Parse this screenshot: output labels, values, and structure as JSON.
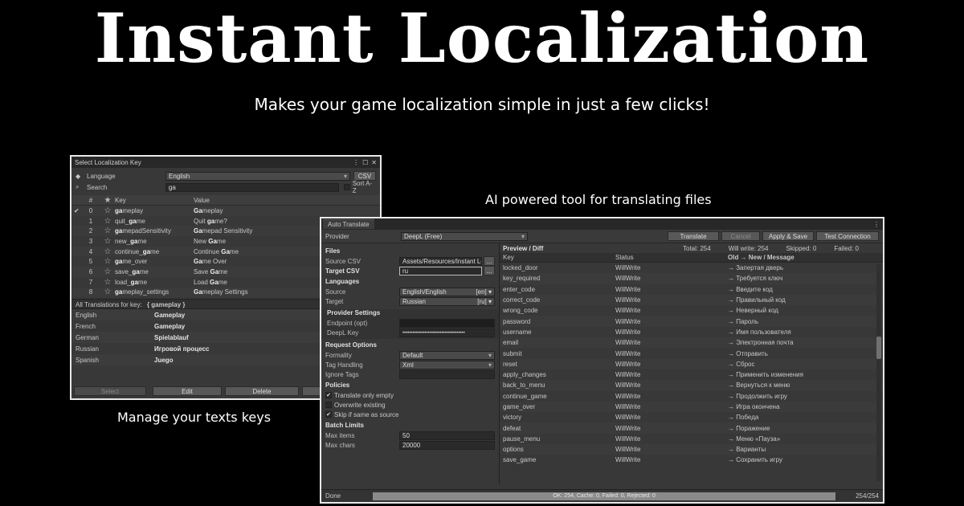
{
  "hero": {
    "title": "Instant Localization",
    "subtitle": "Makes your game localization simple in just a few clicks!"
  },
  "captions": {
    "left": "Manage your texts keys",
    "right": "AI powered tool for translating files"
  },
  "select_window": {
    "title": "Select Localization Key",
    "language_label": "Language",
    "language_value": "English",
    "csv_label": "CSV",
    "search_label": "Search",
    "search_value": "ga",
    "sort_label": "Sort A-Z",
    "col_index": "#",
    "col_key": "Key",
    "col_value": "Value",
    "rows": [
      {
        "idx": "0",
        "key_bold": "ga",
        "key_rest": "meplay",
        "val_bold": "Ga",
        "val_rest": "meplay",
        "checked": "✔"
      },
      {
        "idx": "1",
        "key_pre": "quit_",
        "key_bold": "ga",
        "key_rest": "me",
        "val_pre": "Quit ",
        "val_bold": "ga",
        "val_rest": "me?"
      },
      {
        "idx": "2",
        "key_bold": "ga",
        "key_rest": "mepadSensitivity",
        "val_bold": "Ga",
        "val_rest": "mepad Sensitivity"
      },
      {
        "idx": "3",
        "key_pre": "new_",
        "key_bold": "ga",
        "key_rest": "me",
        "val_pre": "New ",
        "val_bold": "Ga",
        "val_rest": "me"
      },
      {
        "idx": "4",
        "key_pre": "continue_",
        "key_bold": "ga",
        "key_rest": "me",
        "val_pre": "Continue ",
        "val_bold": "Ga",
        "val_rest": "me"
      },
      {
        "idx": "5",
        "key_bold": "ga",
        "key_rest": "me_over",
        "val_bold": "Ga",
        "val_rest": "me Over"
      },
      {
        "idx": "6",
        "key_pre": "save_",
        "key_bold": "ga",
        "key_rest": "me",
        "val_pre": "Save ",
        "val_bold": "Ga",
        "val_rest": "me"
      },
      {
        "idx": "7",
        "key_pre": "load_",
        "key_bold": "ga",
        "key_rest": "me",
        "val_pre": "Load ",
        "val_bold": "Ga",
        "val_rest": "me"
      },
      {
        "idx": "8",
        "key_bold": "ga",
        "key_rest": "meplay_settings",
        "val_bold": "Ga",
        "val_rest": "meplay Settings"
      }
    ],
    "all_translations_label": "All Translations for key:",
    "all_translations_key": "{ gameplay }",
    "translations": [
      {
        "lang": "English",
        "val": "Gameplay"
      },
      {
        "lang": "French",
        "val": "Gameplay"
      },
      {
        "lang": "German",
        "val": "Spielablauf"
      },
      {
        "lang": "Russian",
        "val": "Игровой процесс"
      },
      {
        "lang": "Spanish",
        "val": "Juego"
      }
    ],
    "btn_select": "Select",
    "btn_edit": "Edit",
    "btn_delete": "Delete"
  },
  "auto_window": {
    "tab": "Auto Translate",
    "provider_label": "Provider",
    "provider_value": "DeepL (Free)",
    "btn_translate": "Translate",
    "btn_cancel": "Cancel",
    "btn_apply": "Apply & Save",
    "btn_test": "Test Connection",
    "files_head": "Files",
    "source_csv_label": "Source CSV",
    "source_csv_value": "Assets/Resources/Instant Loc",
    "target_csv_label": "Target CSV",
    "target_csv_value": "ru",
    "browse": "...",
    "languages_head": "Languages",
    "source_label": "Source",
    "source_value": "English/English",
    "source_code": "[en]",
    "target_label": "Target",
    "target_value": "Russian",
    "target_code": "[ru]",
    "provider_settings_head": "Provider Settings",
    "endpoint_label": "Endpoint (opt)",
    "endpoint_value": "",
    "deepl_key_label": "DeepL Key",
    "deepl_key_value": "•••••••••••••••••••••••••••••••••••••",
    "request_head": "Request Options",
    "formality_label": "Formality",
    "formality_value": "Default",
    "tag_label": "Tag Handling",
    "tag_value": "Xml",
    "ignore_label": "Ignore Tags",
    "ignore_value": "",
    "policies_head": "Policies",
    "policy_1": "Translate only empty",
    "policy_2": "Overwrite existing",
    "policy_3": "Skip if same as source",
    "batch_head": "Batch Limits",
    "max_items_label": "Max items",
    "max_items_value": "50",
    "max_chars_label": "Max chars",
    "max_chars_value": "20000",
    "preview_head": "Preview / Diff",
    "total": "Total: 254",
    "will_write": "Will write: 254",
    "skipped": "Skipped: 0",
    "failed": "Failed: 0",
    "col_key": "Key",
    "col_status": "Status",
    "col_new": "Old → New / Message",
    "preview_rows": [
      {
        "key": "locked_door",
        "status": "WillWrite",
        "new": "→ Запертая дверь"
      },
      {
        "key": "key_required",
        "status": "WillWrite",
        "new": "→ Требуется ключ"
      },
      {
        "key": "enter_code",
        "status": "WillWrite",
        "new": "→ Введите код"
      },
      {
        "key": "correct_code",
        "status": "WillWrite",
        "new": "→ Правильный код"
      },
      {
        "key": "wrong_code",
        "status": "WillWrite",
        "new": "→ Неверный код"
      },
      {
        "key": "password",
        "status": "WillWrite",
        "new": "→ Пароль"
      },
      {
        "key": "username",
        "status": "WillWrite",
        "new": "→ Имя пользователя"
      },
      {
        "key": "email",
        "status": "WillWrite",
        "new": "→ Электронная почта"
      },
      {
        "key": "submit",
        "status": "WillWrite",
        "new": "→ Отправить"
      },
      {
        "key": "reset",
        "status": "WillWrite",
        "new": "→ Сброс"
      },
      {
        "key": "apply_changes",
        "status": "WillWrite",
        "new": "→ Применить изменения"
      },
      {
        "key": "back_to_menu",
        "status": "WillWrite",
        "new": "→ Вернуться к меню"
      },
      {
        "key": "continue_game",
        "status": "WillWrite",
        "new": "→ Продолжить игру"
      },
      {
        "key": "game_over",
        "status": "WillWrite",
        "new": "→ Игра окончена"
      },
      {
        "key": "victory",
        "status": "WillWrite",
        "new": "→ Победа"
      },
      {
        "key": "defeat",
        "status": "WillWrite",
        "new": "→ Поражение"
      },
      {
        "key": "pause_menu",
        "status": "WillWrite",
        "new": "→ Меню «Пауза»"
      },
      {
        "key": "options",
        "status": "WillWrite",
        "new": "→ Варианты"
      },
      {
        "key": "save_game",
        "status": "WillWrite",
        "new": "→ Сохранить игру"
      }
    ],
    "status_done": "Done",
    "progress_text": "OK: 254, Cache: 0, Failed: 0, Rejected: 0",
    "progress_count": "254/254"
  }
}
